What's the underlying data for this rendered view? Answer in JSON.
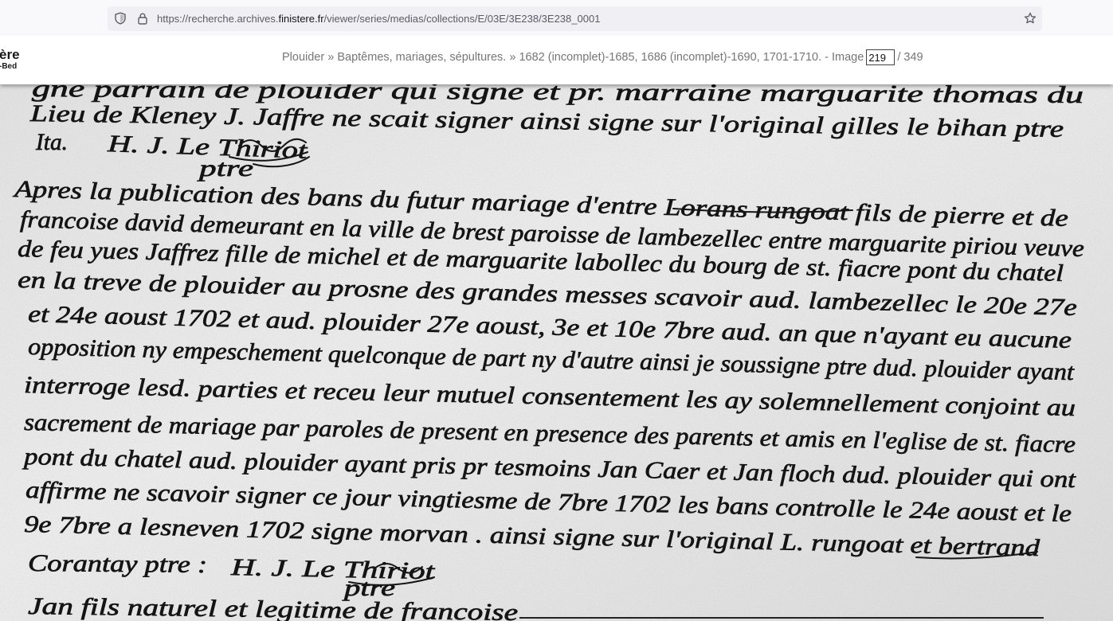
{
  "browser": {
    "url": {
      "prefix": "https://recherche.archives.",
      "domain": "finistere.fr",
      "path": "/viewer/series/medias/collections/E/03E/3E238/3E238_0001"
    },
    "icons": {
      "tracking_protection": "shield-icon",
      "site_info": "lock-icon",
      "bookmark": "star-icon"
    }
  },
  "header": {
    "logo": {
      "line1": "ère",
      "line2": "-Bed"
    },
    "breadcrumb": [
      {
        "label": "Plouider"
      },
      {
        "label": "Baptêmes, mariages, sépultures."
      },
      {
        "label": "1682 (incomplet)-1685, 1686 (incomplet)-1690, 1701-1710."
      }
    ],
    "separator": "»",
    "image_label": "- Image",
    "image_current": "219",
    "image_of": "/",
    "image_total": "349"
  },
  "manuscript": {
    "lines": [
      "gne parrain de plouider qui signe et pr. marraine marguarite thomas du",
      "Lieu de Kleney J. Jaffre ne scait signer ainsi signe sur l'original gilles le bihan ptre",
      "Apres la publication des bans du futur mariage d'entre Lorans rungoat fils de pierre et de",
      "francoise david demeurant en la ville de brest paroisse de lambezellec entre marguarite piriou veuve",
      "de feu yues Jaffrez fille de michel et de marguarite labollec du bourg de st. fiacre pont du chatel",
      "en la treve de plouider au prosne des grandes messes scavoir aud. lambezellec le 20e 27e",
      "et 24e aoust 1702 et aud. plouider 27e aoust, 3e et 10e 7bre aud. an que n'ayant eu aucune",
      "opposition ny empeschement quelconque de part ny d'autre ainsi je soussigne ptre dud. plouider ayant",
      "interroge lesd. parties et receu leur mutuel consentement les ay solemnellement conjoint au",
      "sacrement de mariage par paroles de present en presence des parents et amis en l'eglise de st. fiacre",
      "pont du chatel aud. plouider ayant pris pr tesmoins Jan Caer et Jan floch dud. plouider qui ont",
      "affirme ne scavoir signer ce jour vingtiesme de 7bre 1702 les bans controlle le 24e aoust et le",
      "9e 7bre a lesneven 1702 signe morvan . ainsi signe sur l'original L. rungoat et bertrand",
      "Jan fils naturel et legitime de francoise"
    ],
    "signature_top": {
      "prefix": "Ita.",
      "name": "H. J. Le Thiriot",
      "title": "ptre"
    },
    "signature_bottom": {
      "prefix": "Corantay ptre :",
      "name": "H. J. Le Thiriot",
      "title": "ptre"
    }
  },
  "colors": {
    "toolbar": "#f9f9fb",
    "urlbar": "#f0f0f4",
    "breadcrumb_text": "#767676",
    "paper": "#e6e6e6",
    "ink": "#141414"
  }
}
